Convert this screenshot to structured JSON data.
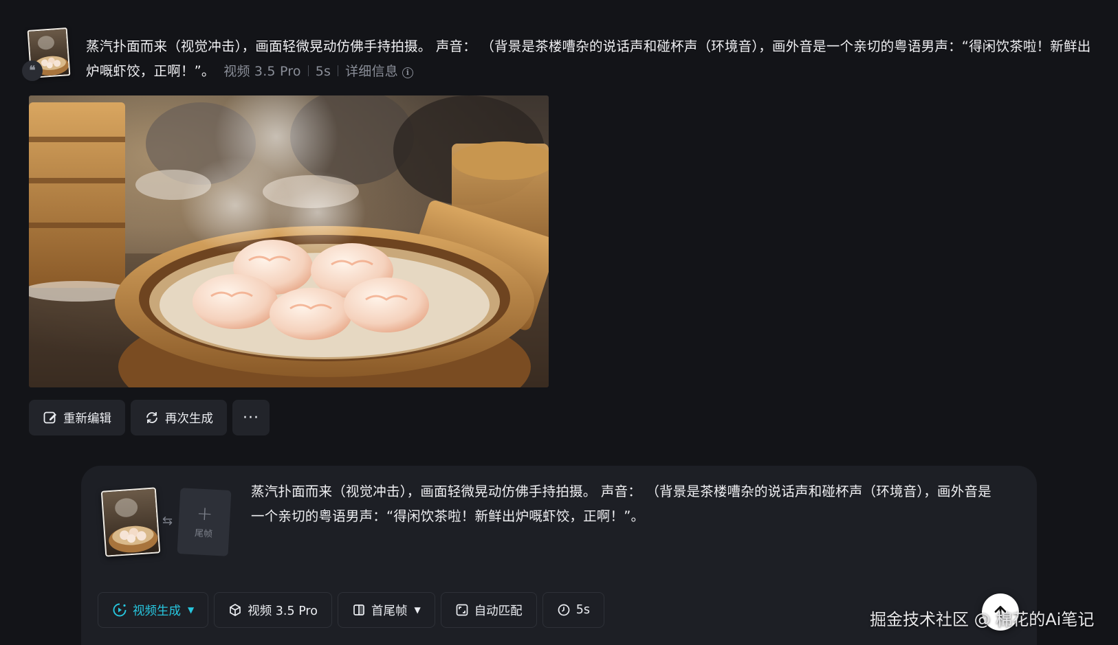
{
  "header": {
    "prompt": "蒸汽扑面而来（视觉冲击），画面轻微晃动仿佛手持拍摄。 声音： （背景是茶楼嘈杂的说话声和碰杯声（环境音），画外音是一个亲切的粤语男声：“得闲饮茶啦！新鲜出炉嘅虾饺，正啊！”。",
    "model": "视频 3.5 Pro",
    "duration": "5s",
    "details_label": "详细信息"
  },
  "actions": {
    "reedit": "重新编辑",
    "regenerate": "再次生成",
    "more": "···"
  },
  "composer": {
    "prompt": "蒸汽扑面而来（视觉冲击），画面轻微晃动仿佛手持拍摄。 声音： （背景是茶楼嘈杂的说话声和碰杯声（环境音），画外音是一个亲切的粤语男声：“得闲饮茶啦！新鲜出炉嘅虾饺，正啊！”。",
    "last_frame_label": "尾帧",
    "toolbar": {
      "mode": "视频生成",
      "model": "视频 3.5 Pro",
      "frames": "首尾帧",
      "ratio": "自动匹配",
      "duration": "5s"
    }
  },
  "watermark": "掘金技术社区 @ 棉花的Ai笔记",
  "colors": {
    "background": "#131418",
    "panel": "#1d1f25",
    "button": "#22242a",
    "accent": "#27c6de",
    "muted": "#8a8e98"
  }
}
